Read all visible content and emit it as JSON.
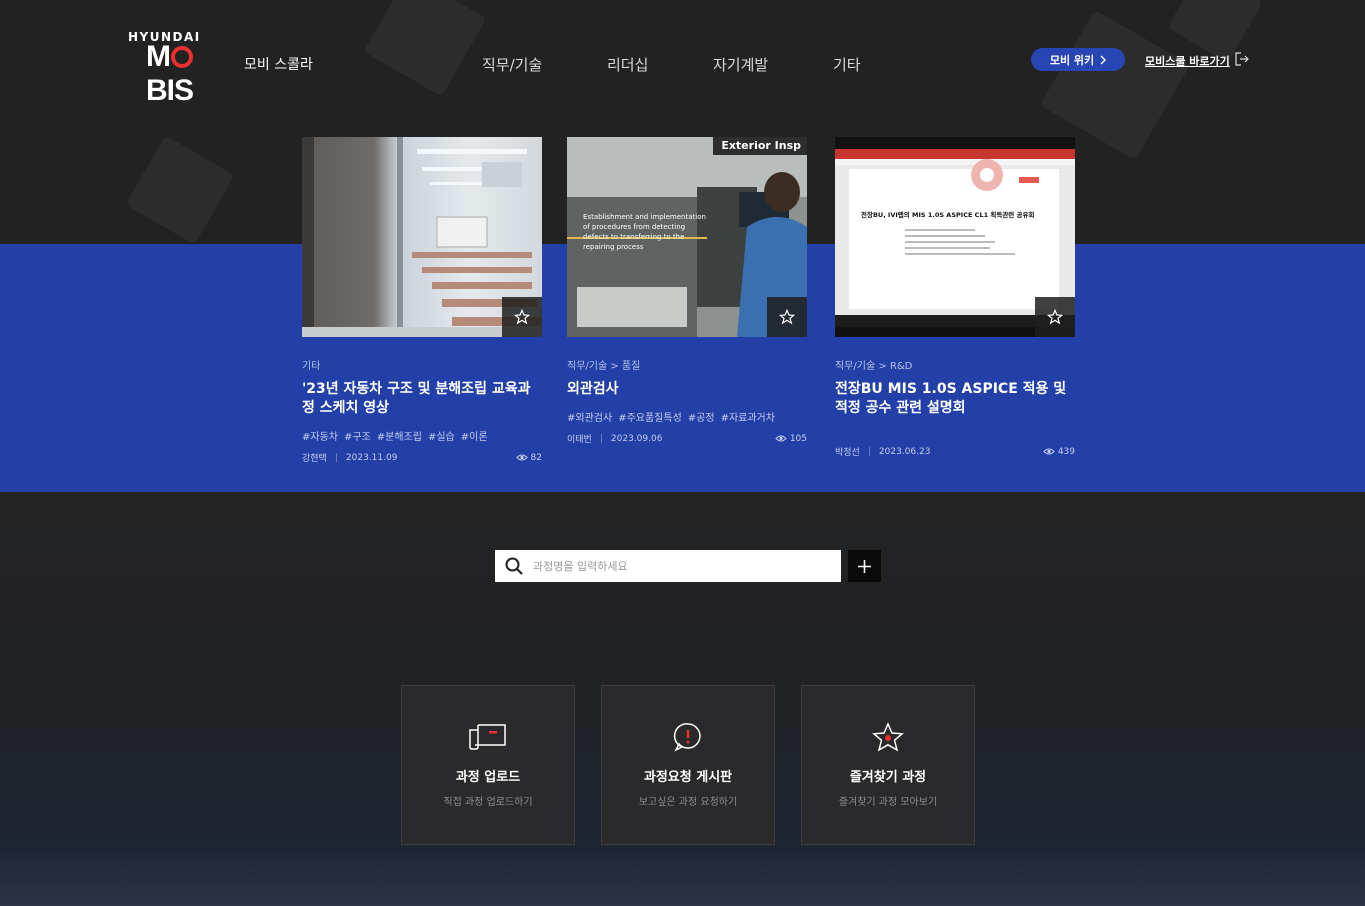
{
  "header": {
    "logo_brand": "HYUNDAI",
    "logo_name": "MOBIS",
    "logo_sub": "모비 스콜라",
    "nav": [
      "직무/기술",
      "리더십",
      "자기계발",
      "기타"
    ],
    "wiki_button": "모비 위키",
    "school_link": "모비스쿨 바로가기"
  },
  "cards": [
    {
      "category": "기타",
      "title": "'23년 자동차 구조 및 분해조립 교육과정 스케치 영상",
      "tags": [
        "#자동차",
        "#구조",
        "#분해조립",
        "#실습",
        "#이론"
      ],
      "author": "강현택",
      "date": "2023.11.09",
      "views": "82"
    },
    {
      "category": "직무/기술 > 품질",
      "title": "외관검사",
      "tags": [
        "#외관검사",
        "#주요품질특성",
        "#공정",
        "#자료과거차"
      ],
      "author": "이태번",
      "date": "2023.09.06",
      "views": "105",
      "thumb_caption": "Exterior Insp",
      "thumb_overlay": "Establishment and implementation of procedures from detecting defects to transferring to the repairing process"
    },
    {
      "category": "직무/기술 > R&D",
      "title": "전장BU MIS 1.0S ASPICE 적용 및 적정 공수 관련 설명회",
      "tags": [],
      "author": "박정선",
      "date": "2023.06.23",
      "views": "439",
      "thumb_doc_title": "전장BU, IVI랩의 MIS 1.0S ASPICE CL1 획득관련 공유회"
    }
  ],
  "search": {
    "placeholder": "과정명을 입력하세요"
  },
  "features": [
    {
      "icon": "upload-icon",
      "title": "과정 업로드",
      "subtitle": "직접 과정 업로드하기"
    },
    {
      "icon": "request-icon",
      "title": "과정요청 게시판",
      "subtitle": "보고싶은 과정 요청하기"
    },
    {
      "icon": "favorite-star-icon",
      "title": "즐겨찾기 과정",
      "subtitle": "즐겨찾기 과정 모아보기"
    }
  ],
  "colors": {
    "brand_blue": "#2240a8",
    "accent_red": "#e8302e",
    "background_dark": "#232324"
  }
}
